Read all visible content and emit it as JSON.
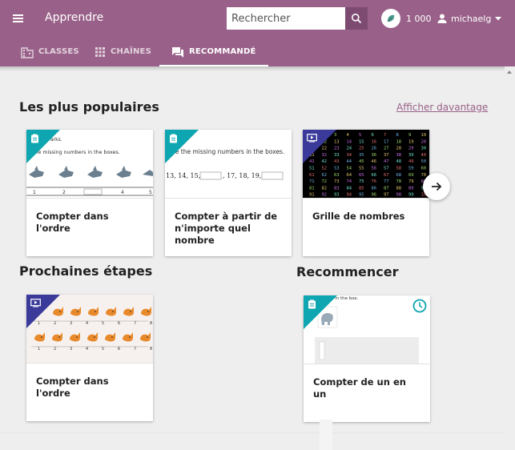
{
  "header": {
    "app_title": "Apprendre",
    "search_placeholder": "Rechercher",
    "points": "1 000",
    "username": "michaelg"
  },
  "tabs": [
    {
      "label": "CLASSES",
      "icon": "building-icon",
      "active": false
    },
    {
      "label": "CHAÎNES",
      "icon": "grid-icon",
      "active": false
    },
    {
      "label": "RECOMMANDÉ",
      "icon": "forum-icon",
      "active": true
    }
  ],
  "sections": {
    "popular": {
      "title": "Les plus populaires",
      "more_link": "Afficher davantage",
      "cards": [
        {
          "title": "Compter dans l'ordre",
          "kind": "exercise",
          "thumb_text": "the missing numbers in the boxes.",
          "thumb_top": "arks."
        },
        {
          "title": "Compter à partir de n'importe quel nombre",
          "kind": "exercise",
          "thumb_text": "pe the missing numbers in the boxes.",
          "seq_a": "13, 14, 15,",
          "seq_b": ", 17, 18, 19,"
        },
        {
          "title": "Grille de nombres",
          "kind": "video"
        }
      ]
    },
    "next_steps": {
      "title": "Prochaines étapes",
      "cards": [
        {
          "title": "Compter dans l'ordre",
          "kind": "video"
        }
      ]
    },
    "restart": {
      "title": "Recommencer",
      "cards": [
        {
          "title": "Compter de un en un",
          "kind": "exercise",
          "thumb_text": "ects in the box."
        }
      ]
    }
  },
  "colors": {
    "brand": "#996189",
    "brand_dark": "#7d4b71",
    "exercise": "#0ea6b1",
    "video": "#3a3a9b",
    "link": "#996189"
  }
}
